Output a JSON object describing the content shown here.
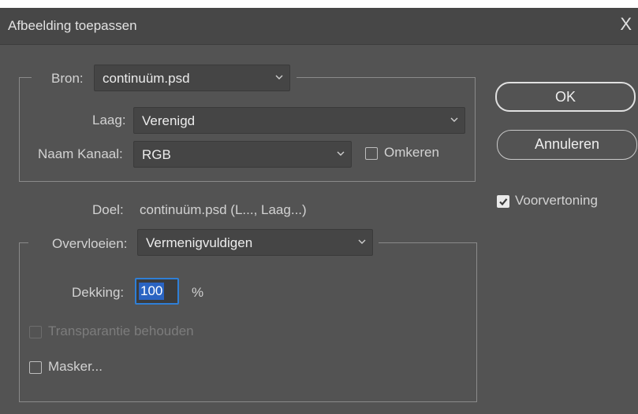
{
  "window": {
    "title": "Afbeelding toepassen",
    "close_glyph": "X"
  },
  "bron": {
    "label": "Bron:",
    "value": "continuüm.psd"
  },
  "laag": {
    "label": "Laag:",
    "value": "Verenigd"
  },
  "kanaal": {
    "label": "Naam Kanaal:",
    "value": "RGB"
  },
  "omkeren": {
    "label": "Omkeren",
    "checked": false
  },
  "doel": {
    "label": "Doel:",
    "value": "continuüm.psd (L..., Laag...)"
  },
  "overvloeien": {
    "label": "Overvloeien:",
    "value": "Vermenigvuldigen"
  },
  "dekking": {
    "label": "Dekking:",
    "value": "100",
    "unit": "%"
  },
  "transparantie": {
    "label": "Transparantie behouden",
    "checked": false,
    "disabled": true
  },
  "masker": {
    "label": "Masker...",
    "checked": false
  },
  "buttons": {
    "ok": "OK",
    "cancel": "Annuleren"
  },
  "voorvertoning": {
    "label": "Voorvertoning",
    "checked": true
  },
  "colors": {
    "background": "#535353",
    "titlebar": "#474747",
    "focus": "#2f7fd6"
  }
}
